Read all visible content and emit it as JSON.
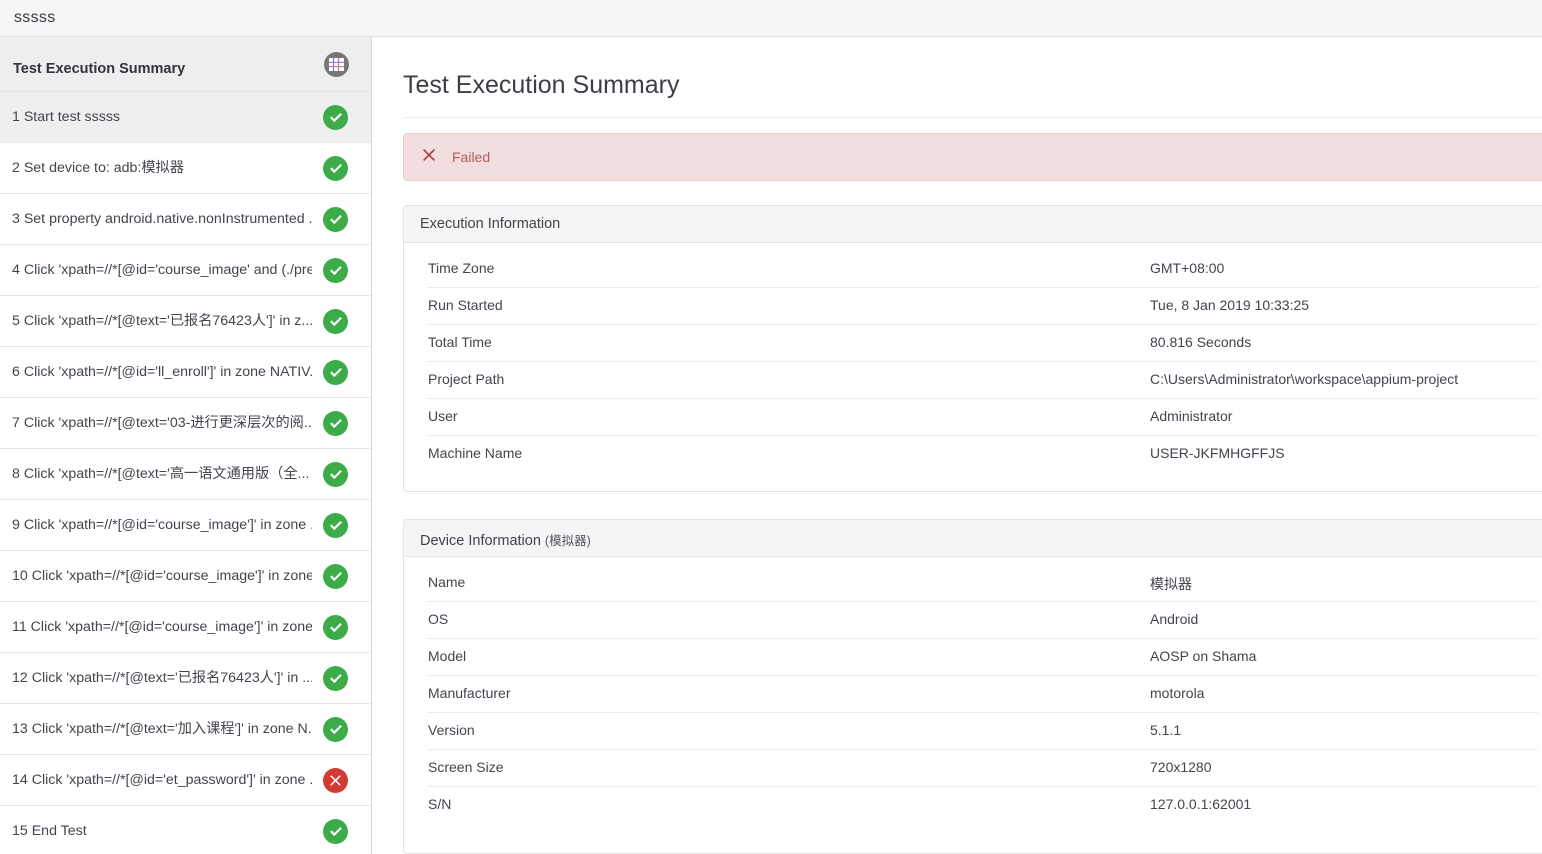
{
  "window": {
    "title": "sssss"
  },
  "sidebar": {
    "header": {
      "title": "Test Execution Summary",
      "icon": "table-grid-icon"
    },
    "scrollbar": {
      "arrow": "scroll-up-arrow-icon"
    },
    "steps": [
      {
        "label": "1 Start test sssss",
        "status": "pass",
        "selected": true
      },
      {
        "label": "2 Set device to: adb:模拟器",
        "status": "pass",
        "selected": false
      },
      {
        "label": "3 Set property android.native.nonInstrumented ...",
        "status": "pass",
        "selected": false
      },
      {
        "label": "4 Click 'xpath=//*[@id='course_image' and (./pre...",
        "status": "pass",
        "selected": false
      },
      {
        "label": "5 Click 'xpath=//*[@text='已报名76423人']' in z...",
        "status": "pass",
        "selected": false
      },
      {
        "label": "6 Click 'xpath=//*[@id='ll_enroll']' in zone NATIV...",
        "status": "pass",
        "selected": false
      },
      {
        "label": "7 Click 'xpath=//*[@text='03-进行更深层次的阅...",
        "status": "pass",
        "selected": false
      },
      {
        "label": "8 Click 'xpath=//*[@text='高一语文通用版（全...",
        "status": "pass",
        "selected": false
      },
      {
        "label": "9 Click 'xpath=//*[@id='course_image']' in zone ...",
        "status": "pass",
        "selected": false
      },
      {
        "label": "10 Click 'xpath=//*[@id='course_image']' in zone...",
        "status": "pass",
        "selected": false
      },
      {
        "label": "11 Click 'xpath=//*[@id='course_image']' in zone...",
        "status": "pass",
        "selected": false
      },
      {
        "label": "12 Click 'xpath=//*[@text='已报名76423人']' in ...",
        "status": "pass",
        "selected": false
      },
      {
        "label": "13 Click 'xpath=//*[@text='加入课程']' in zone N...",
        "status": "pass",
        "selected": false
      },
      {
        "label": "14 Click 'xpath=//*[@id='et_password']' in zone ...",
        "status": "fail",
        "selected": false
      },
      {
        "label": "15 End Test",
        "status": "pass",
        "selected": false
      }
    ]
  },
  "main": {
    "page_title": "Test Execution Summary",
    "alert": {
      "icon": "x-mark-icon",
      "text": "Failed",
      "background": "#f2dede",
      "border": "#ebccd1",
      "text_color": "#b45b5b"
    },
    "execution_panel": {
      "title": "Execution Information",
      "rows": [
        {
          "key": "Time Zone",
          "value": "GMT+08:00"
        },
        {
          "key": "Run Started",
          "value": "Tue, 8 Jan 2019 10:33:25"
        },
        {
          "key": "Total Time",
          "value": "80.816 Seconds"
        },
        {
          "key": "Project Path",
          "value": "C:\\Users\\Administrator\\workspace\\appium-project"
        },
        {
          "key": "User",
          "value": "Administrator"
        },
        {
          "key": "Machine Name",
          "value": "USER-JKFMHGFFJS"
        }
      ]
    },
    "device_panel": {
      "title": "Device Information",
      "subtitle": "(模拟器)",
      "rows": [
        {
          "key": "Name",
          "value": "模拟器"
        },
        {
          "key": "OS",
          "value": "Android"
        },
        {
          "key": "Model",
          "value": "AOSP on Shama"
        },
        {
          "key": "Manufacturer",
          "value": "motorola"
        },
        {
          "key": "Version",
          "value": "5.1.1"
        },
        {
          "key": "Screen Size",
          "value": "720x1280"
        },
        {
          "key": "S/N",
          "value": "127.0.0.1:62001"
        }
      ]
    }
  },
  "colors": {
    "pass": "#3cab48",
    "fail": "#d33a32",
    "titlebar": "#f6f6f6",
    "panel_header": "#f5f5f5"
  }
}
